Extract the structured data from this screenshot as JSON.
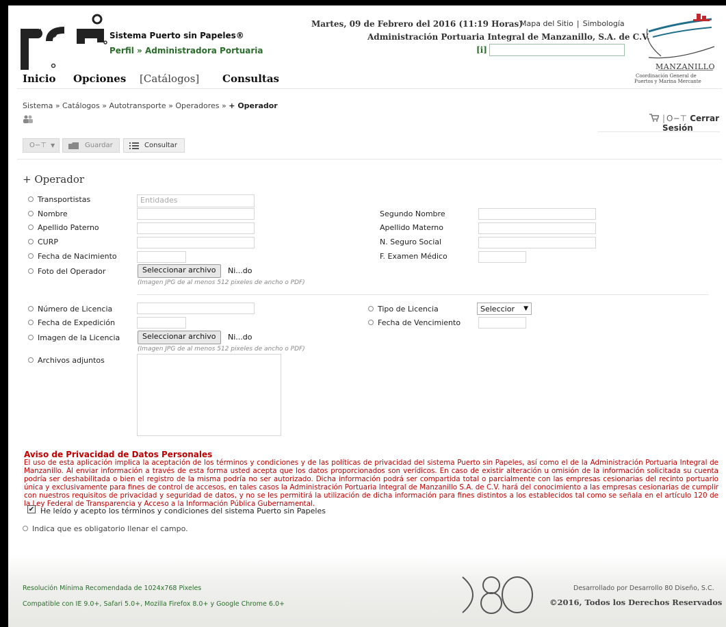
{
  "header": {
    "system_name": "Sistema Puerto sin Papeles®",
    "profile": "Perfil » Administradora Portuaria",
    "date": "Martes, 09 de Febrero del 2016 (11:19 Horas)",
    "site_map": "Mapa del Sitio",
    "link_separator": "|",
    "symbology": "Simbología",
    "admin_name": "Administración Portuaria Integral de Manzanillo, S.A. de C.V.",
    "info_link": "[i]",
    "brand_logo_text": "psp",
    "right_logo": {
      "title": "MANZANILLO",
      "subtitle_line1": "Coordinación General de",
      "subtitle_line2": "Puertos y Marina Mercante"
    }
  },
  "nav": {
    "items": [
      {
        "label": "Inicio"
      },
      {
        "label": "Opciones"
      },
      {
        "label": "[Catálogos]"
      },
      {
        "label": "Consultas"
      }
    ]
  },
  "breadcrumb": {
    "items": [
      "Sistema",
      "Catálogos",
      "Autotransporte",
      "Operadores"
    ],
    "separator": "»",
    "current": "+ Operador"
  },
  "session": {
    "cart_icon": "cart-icon",
    "key_icon": "key-icon",
    "logout_label": "Cerrar Sesión"
  },
  "toolbar": {
    "key_menu_icon": "key-icon",
    "save_label": "Guardar",
    "consult_label": "Consultar"
  },
  "form": {
    "title": "+ Operador",
    "fields": {
      "transportistas": {
        "label": "Transportistas",
        "placeholder": "Entidades"
      },
      "nombre": {
        "label": "Nombre"
      },
      "segundo_nombre": {
        "label": "Segundo Nombre"
      },
      "apellido_paterno": {
        "label": "Apellido Paterno"
      },
      "apellido_materno": {
        "label": "Apellido Materno"
      },
      "curp": {
        "label": "CURP"
      },
      "nss": {
        "label": "N. Seguro Social"
      },
      "fecha_nacimiento": {
        "label": "Fecha de Nacimiento"
      },
      "examen_medico": {
        "label": "F. Examen Médico"
      },
      "foto_operador": {
        "label": "Foto del Operador",
        "button": "Seleccionar archivo",
        "file_name": "Ni...do",
        "hint": "(Imagen JPG de al menos 512 pixeles de ancho o PDF)"
      },
      "numero_licencia": {
        "label": "Número de Licencia"
      },
      "tipo_licencia": {
        "label": "Tipo de Licencia",
        "selected": "Seleccior"
      },
      "fecha_expedicion": {
        "label": "Fecha de Expedición"
      },
      "fecha_vencimiento": {
        "label": "Fecha de Vencimiento"
      },
      "imagen_licencia": {
        "label": "Imagen de la Licencia",
        "button": "Seleccionar archivo",
        "file_name": "Ni...do",
        "hint": "(Imagen JPG de al menos 512 pixeles de ancho o PDF)"
      },
      "archivos_adjuntos": {
        "label": "Archivos adjuntos"
      }
    }
  },
  "privacy": {
    "title": "Aviso de Privacidad de Datos Personales",
    "text": "El uso de esta aplicación implica la aceptación de los términos y condiciones y de las políticas de privacidad del sistema Puerto sin Papeles, así como el de la Administración Portuaria Integral de Manzanillo. Al enviar información a través de esta forma usted acepta que los datos proporcionados son verídicos. En caso de existir alteración u omisión de la información solicitada su cuenta podría ser deshabilitada o bien el registro de la misma podría no ser autorizado. Dicha información podrá ser compartida total o parcialmente con las empresas cesionarias del recinto portuario única y exclusivamente para fines de control de accesos, en tales casos la Administración Portuaria Integral de Manzanillo S.A. de C.V. hará del conocimiento a las empresas cesionarias de cumplir con nuestros requisitos de privacidad y seguridad de datos, y no se les permitirá la utilización de dicha información para fines distintos a los establecidos tal como se señala en el artículo 120 de la Ley Federal de Transparencia y Acceso a la Información Pública Gubernamental.",
    "accept_checked": true,
    "accept_label": "He leído y acepto los términos y condiciones del sistema Puerto sin Papeles",
    "required_note": "Indica que es obligatorio llenar el campo."
  },
  "footer": {
    "resolution": "Resolución Mínima Recomendada de 1024x768 Pixeles",
    "compatibility": "Compatible con IE 9.0+, Safari 5.0+, Mozilla Firefox 8.0+ y Google Chrome 6.0+",
    "developer_logo": "D80",
    "developed_by": "Desarrollado por Desarrollo 80 Diseño, S.C.",
    "copyright": "©2016, Todos los Derechos Reservados"
  },
  "colors": {
    "brand_green": "#2a6e2a",
    "privacy_red": "#c00000"
  }
}
